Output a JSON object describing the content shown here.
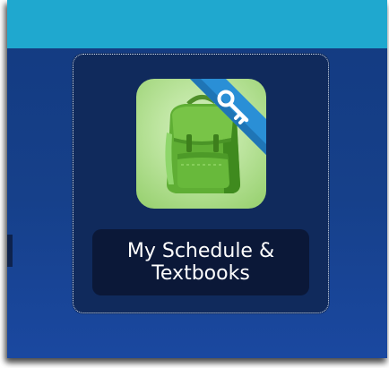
{
  "app_tile": {
    "label_line1": "My Schedule &",
    "label_line2": "Textbooks",
    "icon": "green-backpack-icon",
    "badge_icon": "key-icon"
  },
  "colors": {
    "top_bar": "#1fa8cf",
    "panel_background": "#16408a",
    "tile_background": "#102a5c",
    "label_background": "#0b1838",
    "badge_ribbon": "#2a8fd6"
  }
}
